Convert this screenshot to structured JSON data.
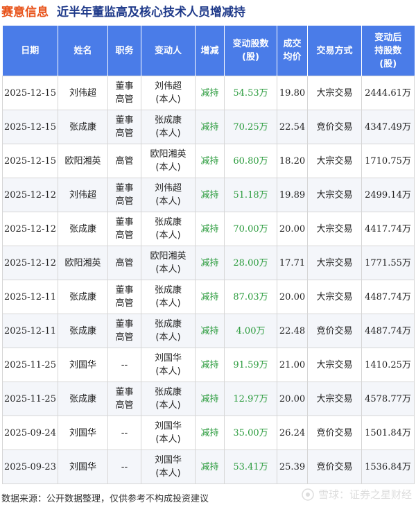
{
  "header": {
    "company": "赛意信息",
    "title": "近半年董监高及核心技术人员增减持"
  },
  "table": {
    "columns": [
      "日期",
      "姓名",
      "职务",
      "变动人",
      "增减",
      "变动股数\n(股)",
      "成交\n均价",
      "交易方式",
      "变动后\n持股数\n(股)"
    ],
    "rows": [
      {
        "date": "2025-12-15",
        "name": "刘伟超",
        "position": "董事\n高管",
        "changer": "刘伟超\n(本人)",
        "change": "减持",
        "amount": "54.53万",
        "price": "19.80",
        "method": "大宗交易",
        "holding": "2444.61万"
      },
      {
        "date": "2025-12-15",
        "name": "张成康",
        "position": "董事\n高管",
        "changer": "张成康\n(本人)",
        "change": "减持",
        "amount": "70.25万",
        "price": "22.54",
        "method": "竞价交易",
        "holding": "4347.49万"
      },
      {
        "date": "2025-12-15",
        "name": "欧阳湘英",
        "position": "高管",
        "changer": "欧阳湘英\n(本人)",
        "change": "减持",
        "amount": "60.80万",
        "price": "18.20",
        "method": "大宗交易",
        "holding": "1710.75万"
      },
      {
        "date": "2025-12-12",
        "name": "刘伟超",
        "position": "董事\n高管",
        "changer": "刘伟超\n(本人)",
        "change": "减持",
        "amount": "51.18万",
        "price": "19.89",
        "method": "大宗交易",
        "holding": "2499.14万"
      },
      {
        "date": "2025-12-12",
        "name": "张成康",
        "position": "董事\n高管",
        "changer": "张成康\n(本人)",
        "change": "减持",
        "amount": "70.00万",
        "price": "20.00",
        "method": "大宗交易",
        "holding": "4417.74万"
      },
      {
        "date": "2025-12-12",
        "name": "欧阳湘英",
        "position": "高管",
        "changer": "欧阳湘英\n(本人)",
        "change": "减持",
        "amount": "28.00万",
        "price": "17.71",
        "method": "大宗交易",
        "holding": "1771.55万"
      },
      {
        "date": "2025-12-11",
        "name": "张成康",
        "position": "董事\n高管",
        "changer": "张成康\n(本人)",
        "change": "减持",
        "amount": "87.03万",
        "price": "20.00",
        "method": "大宗交易",
        "holding": "4487.74万"
      },
      {
        "date": "2025-12-11",
        "name": "张成康",
        "position": "董事\n高管",
        "changer": "张成康\n(本人)",
        "change": "减持",
        "amount": "4.00万",
        "price": "22.48",
        "method": "竞价交易",
        "holding": "4487.74万"
      },
      {
        "date": "2025-11-25",
        "name": "刘国华",
        "position": "--",
        "changer": "刘国华\n(本人)",
        "change": "减持",
        "amount": "91.59万",
        "price": "21.00",
        "method": "大宗交易",
        "holding": "1410.25万"
      },
      {
        "date": "2025-11-25",
        "name": "张成康",
        "position": "董事\n高管",
        "changer": "张成康\n(本人)",
        "change": "减持",
        "amount": "12.97万",
        "price": "20.00",
        "method": "大宗交易",
        "holding": "4578.77万"
      },
      {
        "date": "2025-09-24",
        "name": "刘国华",
        "position": "--",
        "changer": "刘国华\n(本人)",
        "change": "减持",
        "amount": "35.00万",
        "price": "26.24",
        "method": "竞价交易",
        "holding": "1501.84万"
      },
      {
        "date": "2025-09-23",
        "name": "刘国华",
        "position": "--",
        "changer": "刘国华\n(本人)",
        "change": "减持",
        "amount": "53.41万",
        "price": "25.39",
        "method": "竞价交易",
        "holding": "1536.84万"
      }
    ]
  },
  "footer": {
    "source": "数据来源：公开数据整理，仅供参考不构成投资建议",
    "brand": "雪球：证券之星财经"
  },
  "colors": {
    "header_bg": "#4a7ce8",
    "company": "#e8531a",
    "title": "#1f3a8a",
    "decrease": "#2a9b3c"
  }
}
